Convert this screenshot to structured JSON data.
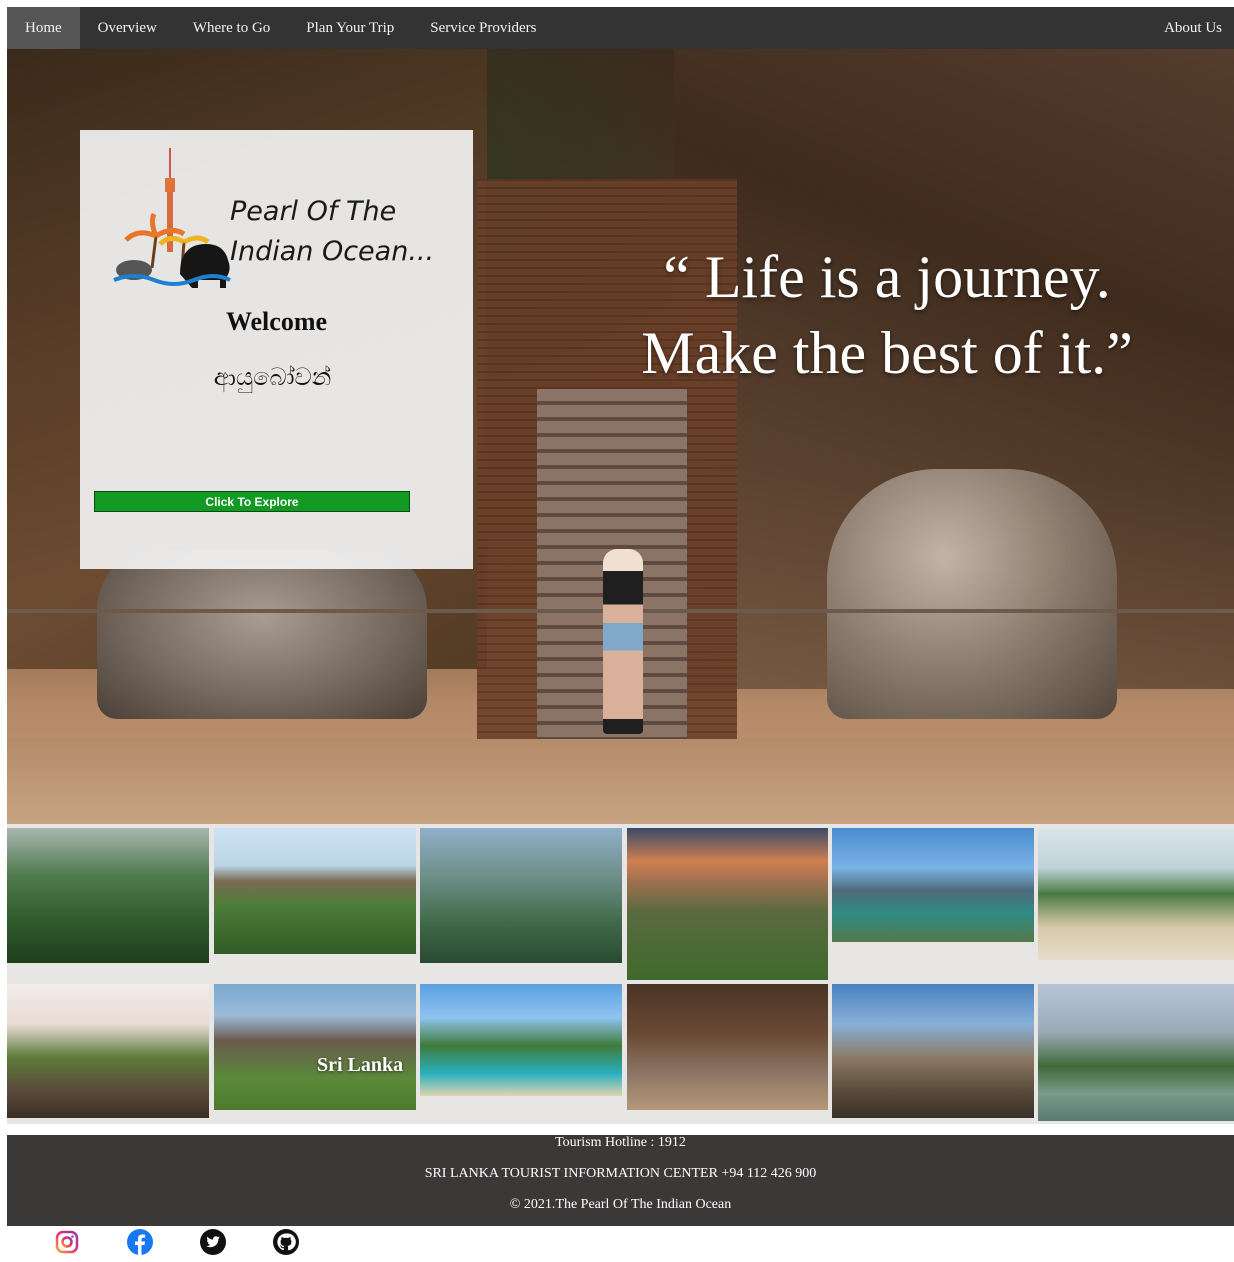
{
  "nav": {
    "items": [
      {
        "label": "Home",
        "active": true
      },
      {
        "label": "Overview"
      },
      {
        "label": "Where to Go"
      },
      {
        "label": "Plan Your Trip"
      },
      {
        "label": "Service Providers"
      }
    ],
    "right": {
      "label": "About Us"
    }
  },
  "hero": {
    "quote_line1": "“ Life is a journey.",
    "quote_line2": "Make the best of it.”"
  },
  "card": {
    "logo_line1": "Pearl Of The",
    "logo_line2": "Indian Ocean...",
    "welcome": "Welcome",
    "sinhala": "ආයුබෝවන්",
    "button_label": "Click To Explore",
    "button_color": "#139a23"
  },
  "gallery": {
    "overlay_label": "Sri Lanka"
  },
  "footer": {
    "hotline": "Tourism Hotline : 1912",
    "info_center": "SRI LANKA TOURIST INFORMATION CENTER +94 112 426 900",
    "copyright": "© 2021.The Pearl Of The Indian Ocean",
    "background": "#3b3838"
  },
  "social": {
    "icons": [
      "instagram-icon",
      "facebook-icon",
      "twitter-icon",
      "github-icon"
    ]
  }
}
